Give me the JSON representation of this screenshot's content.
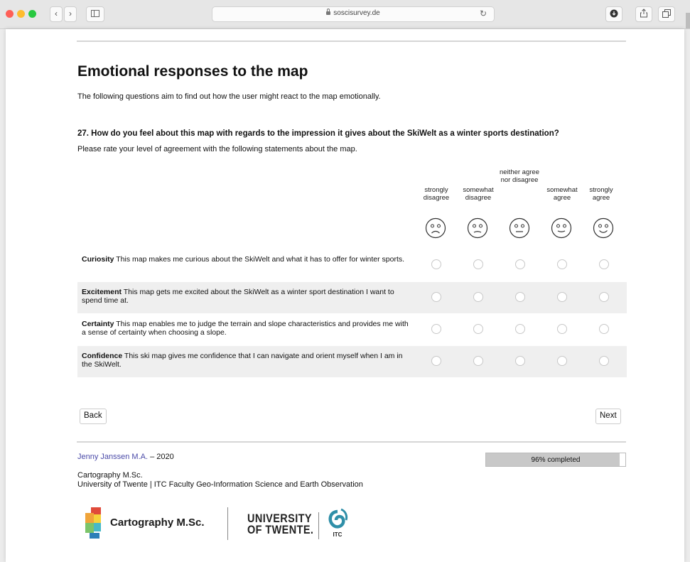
{
  "browser": {
    "url": "soscisurvey.de"
  },
  "page": {
    "title": "Emotional responses to the map",
    "intro": "The following questions aim to find out how the user might react to the map emotionally.",
    "question": "27. How do you feel about this map with regards to the impression it gives about the SkiWelt as a winter sports destination?",
    "instruction": "Please rate your level of agreement with the following statements about the map.",
    "scale": [
      {
        "label": "strongly disagree",
        "face": "very-sad-face-icon"
      },
      {
        "label": "somewhat disagree",
        "face": "sad-face-icon"
      },
      {
        "label": "neither agree nor disagree",
        "face": "neutral-face-icon"
      },
      {
        "label": "somewhat agree",
        "face": "smile-face-icon"
      },
      {
        "label": "strongly agree",
        "face": "happy-face-icon"
      }
    ],
    "items": [
      {
        "term": "Curiosity",
        "text": "This map makes me curious about the SkiWelt and what it has to offer for winter sports."
      },
      {
        "term": "Excitement",
        "text": "This map gets me excited about the SkiWelt as a winter sport destination I want to spend time at."
      },
      {
        "term": "Certainty",
        "text": "This map enables me to judge the terrain and slope characteristics and provides me with a sense of certainty when choosing a slope."
      },
      {
        "term": "Confidence",
        "text": "This ski map gives me confidence that I can navigate and orient myself when I am in the SkiWelt."
      }
    ],
    "buttons": {
      "back": "Back",
      "next": "Next"
    },
    "footer": {
      "author_name": "Jenny Janssen M.A.",
      "author_year": "– 2020",
      "org_line1": "Cartography M.Sc.",
      "org_line2": "University of Twente | ITC Faculty Geo-Information Science and Earth Observation",
      "progress_value": 0.96,
      "progress_text": "96% completed"
    },
    "logos": {
      "cartography": "Cartography M.Sc.",
      "twente_line1": "UNIVERSITY",
      "twente_line2": "OF TWENTE.",
      "itc": "ITC"
    }
  }
}
